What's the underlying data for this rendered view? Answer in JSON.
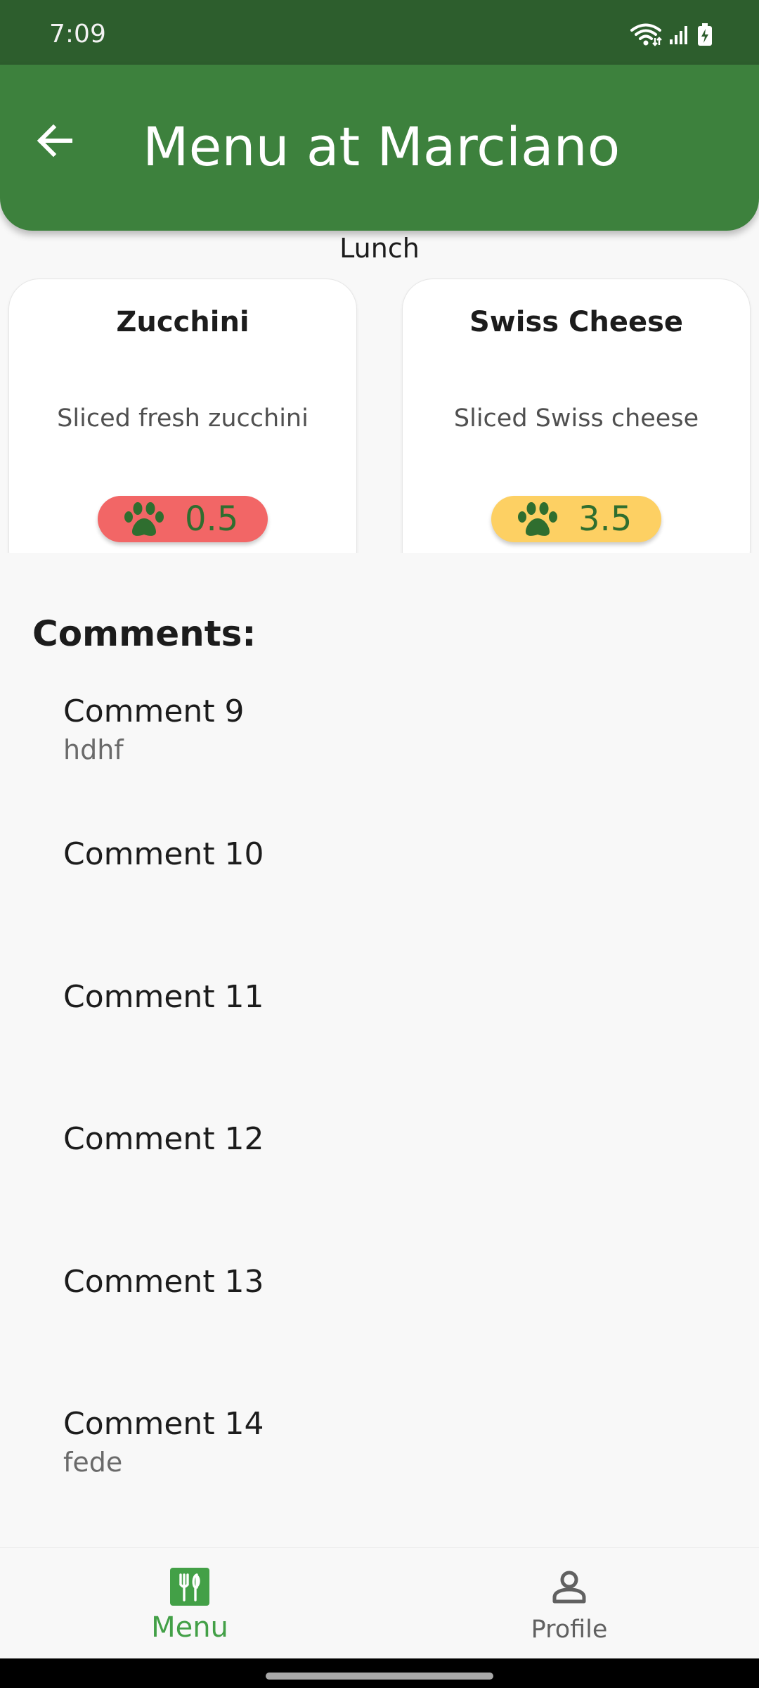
{
  "status_bar": {
    "time": "7:09",
    "icons": [
      "wifi-icon",
      "signal-icon",
      "battery-charging-icon"
    ]
  },
  "app_bar": {
    "title": "Menu at Marciano",
    "back_icon": "arrow-left-icon"
  },
  "meal": "Lunch",
  "cards": [
    {
      "title": "Zucchini",
      "description": "Sliced fresh zucchini",
      "rating": "0.5",
      "rating_color": "#f26666",
      "rating_icon": "paw-icon"
    },
    {
      "title": "Swiss Cheese",
      "description": "Sliced Swiss cheese",
      "rating": "3.5",
      "rating_color": "#fdd063",
      "rating_icon": "paw-icon"
    }
  ],
  "comments": {
    "heading": "Comments:",
    "items": [
      {
        "title": "Comment 9",
        "subtitle": "hdhf"
      },
      {
        "title": "Comment 10",
        "subtitle": ""
      },
      {
        "title": "Comment 11",
        "subtitle": ""
      },
      {
        "title": "Comment 12",
        "subtitle": ""
      },
      {
        "title": "Comment 13",
        "subtitle": ""
      },
      {
        "title": "Comment 14",
        "subtitle": "fede"
      }
    ]
  },
  "bottom_nav": {
    "items": [
      {
        "label": "Menu",
        "icon": "restaurant-icon",
        "selected": true
      },
      {
        "label": "Profile",
        "icon": "person-icon",
        "selected": false
      }
    ]
  },
  "colors": {
    "status_bar": "#2d5e2d",
    "app_bar": "#3d813d",
    "accent_green": "#43a047",
    "paw_green": "#2f6e2f"
  }
}
